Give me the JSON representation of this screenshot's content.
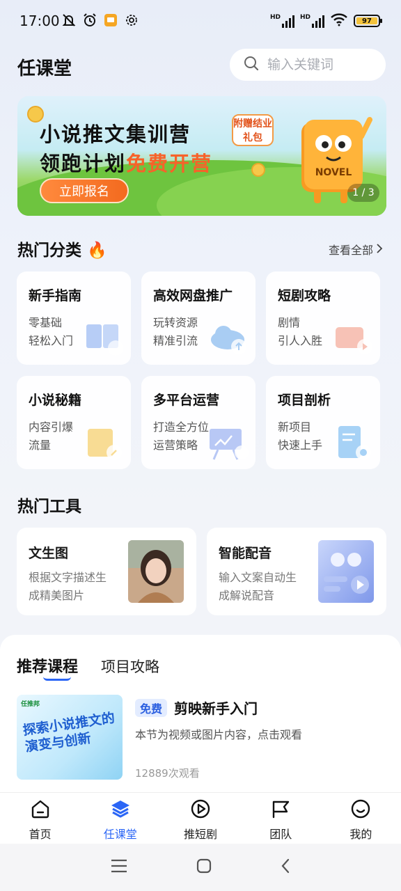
{
  "status_bar": {
    "time": "17:00",
    "battery": "97"
  },
  "header": {
    "title": "任课堂",
    "search_placeholder": "输入关键词"
  },
  "banner": {
    "line1": "小说推文集训营",
    "line2_prefix": "领跑计划",
    "line2_highlight": "免费开营",
    "gift_tag": "附赠结业礼包",
    "cta": "立即报名",
    "pager": "1 / 3",
    "mascot_text": "NOVEL"
  },
  "categories": {
    "title": "热门分类",
    "view_all": "查看全部",
    "items": [
      {
        "title": "新手指南",
        "line1": "零基础",
        "line2": "轻松入门",
        "icon": "book-icon",
        "color": "#b7cdf6"
      },
      {
        "title": "高效网盘推广",
        "line1": "玩转资源",
        "line2": "精准引流",
        "icon": "cloud-icon",
        "color": "#a9cdf3"
      },
      {
        "title": "短剧攻略",
        "line1": "剧情",
        "line2": "引人入胜",
        "icon": "video-icon",
        "color": "#f7c2b6"
      },
      {
        "title": "小说秘籍",
        "line1": "内容引爆",
        "line2": "流量",
        "icon": "notebook-icon",
        "color": "#f8dc94"
      },
      {
        "title": "多平台运营",
        "line1": "打造全方位",
        "line2": "运营策略",
        "icon": "presentation-icon",
        "color": "#b8c8f5"
      },
      {
        "title": "项目剖析",
        "line1": "新项目",
        "line2": "快速上手",
        "icon": "document-icon",
        "color": "#a7d2f6"
      }
    ]
  },
  "tools": {
    "title": "热门工具",
    "items": [
      {
        "title": "文生图",
        "line1": "根据文字描述生",
        "line2": "成精美图片"
      },
      {
        "title": "智能配音",
        "line1": "输入文案自动生",
        "line2": "成解说配音"
      }
    ]
  },
  "course_tabs": {
    "active": "推荐课程",
    "other": "项目攻略"
  },
  "course": {
    "thumb_brand": "任推邦",
    "thumb_title": "探索小说推文的演变与创新",
    "badge": "免费",
    "title": "剪映新手入门",
    "desc": "本节为视频或图片内容，点击观看",
    "views": "12889次观看"
  },
  "bottom_nav": [
    {
      "label": "首页",
      "icon": "home-icon",
      "active": false
    },
    {
      "label": "任课堂",
      "icon": "layers-icon",
      "active": true
    },
    {
      "label": "推短剧",
      "icon": "play-icon",
      "active": false
    },
    {
      "label": "团队",
      "icon": "flag-icon",
      "active": false
    },
    {
      "label": "我的",
      "icon": "smile-icon",
      "active": false
    }
  ],
  "colors": {
    "accent": "#2b66f6",
    "orange": "#f7622a",
    "background": "#eef2fa"
  }
}
